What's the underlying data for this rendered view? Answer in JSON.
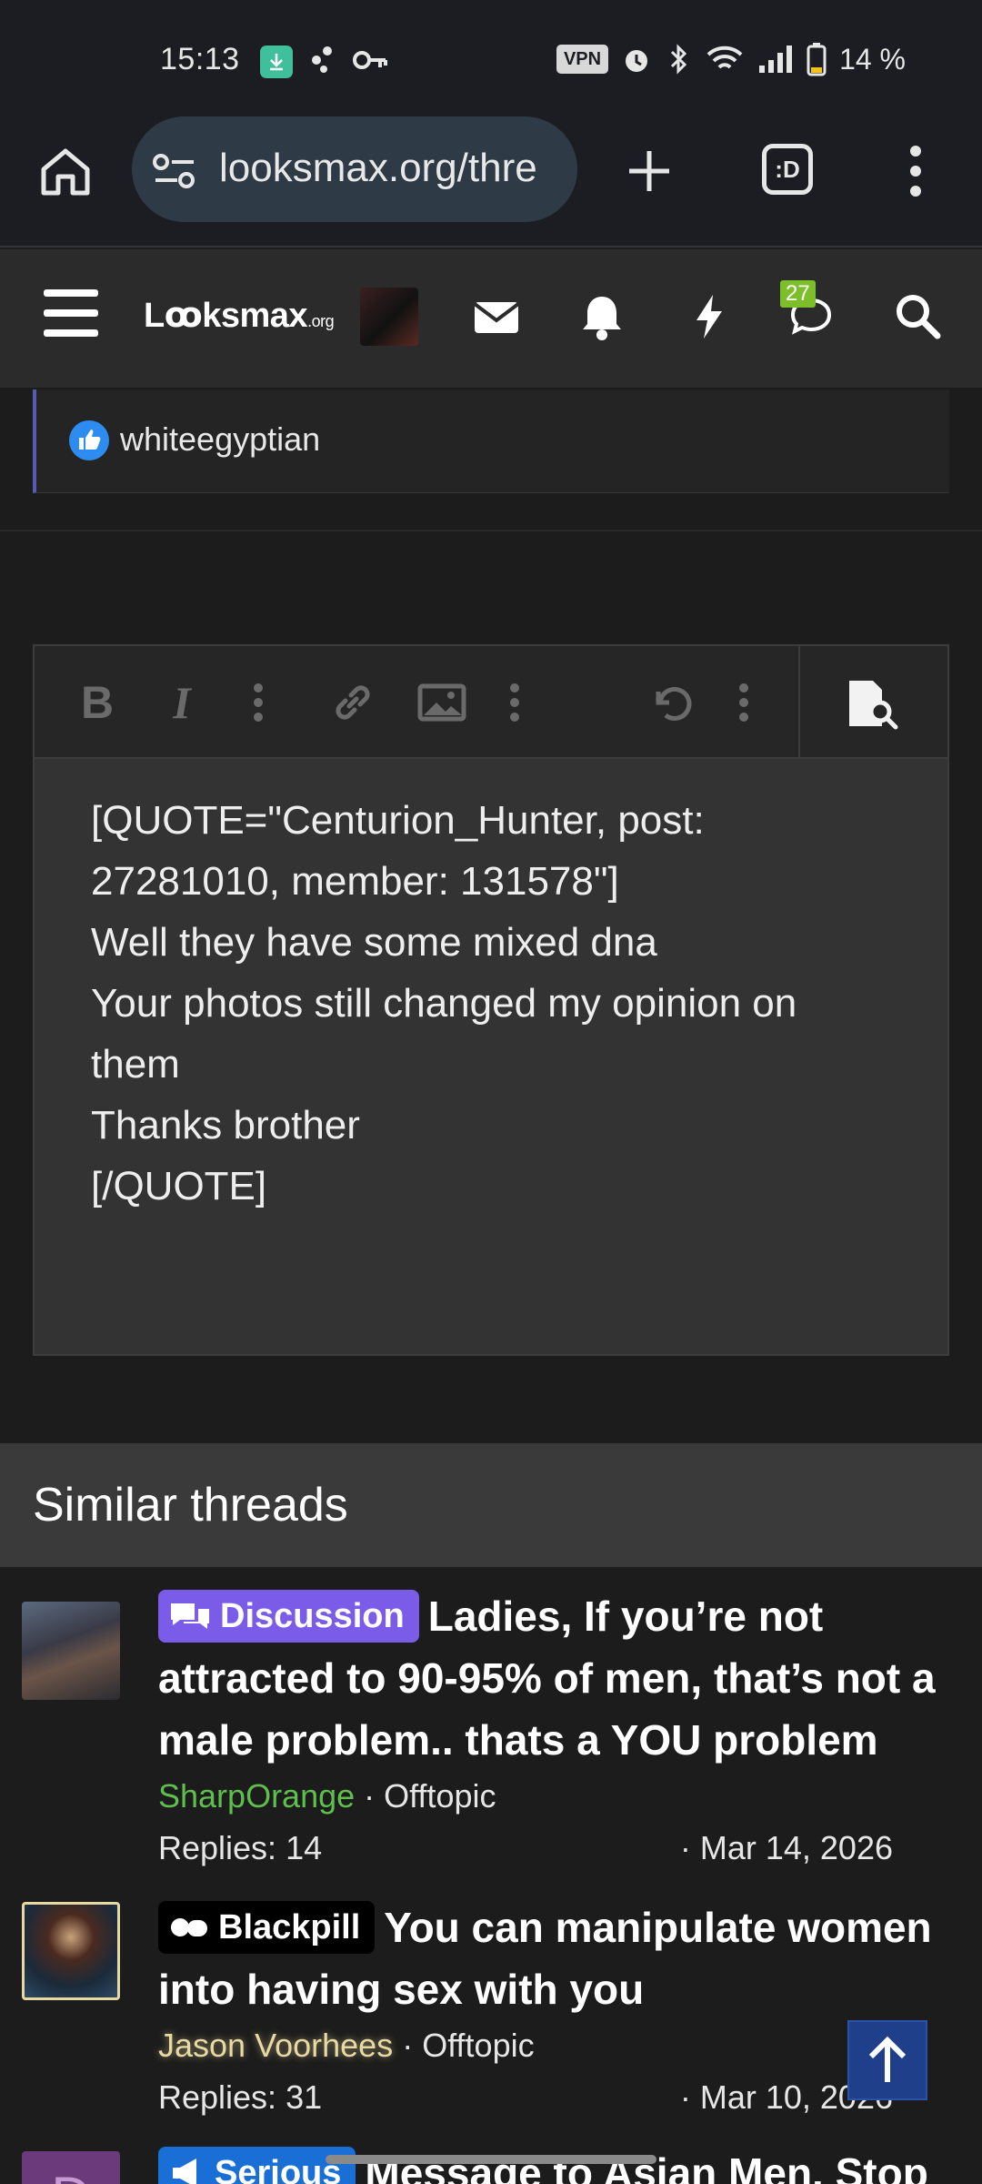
{
  "status_bar": {
    "time": "15:13",
    "vpn": "VPN",
    "battery": "14 %"
  },
  "browser": {
    "url": "looksmax.org/thre",
    "tab_label": ":D"
  },
  "site_nav": {
    "logo_main": "Lꝏksmax",
    "logo_suffix": ".org",
    "chat_badge": "27"
  },
  "reaction": {
    "user": "whiteegyptian"
  },
  "editor": {
    "content": "[QUOTE=\"Centurion_Hunter, post: 27281010, member: 131578\"]\nWell they have some mixed dna\nYour photos still changed my opinion on them\nThanks brother\n[/QUOTE]",
    "toolbar": {
      "bold": "B",
      "italic": "I"
    }
  },
  "similar": {
    "heading": "Similar threads",
    "threads": [
      {
        "prefix": "Discussion",
        "title": "Ladies, If you’re not attracted to 90-95% of men, that’s not a male problem.. thats a YOU problem",
        "author": "SharpOrange",
        "forum": "Offtopic",
        "replies": "Replies: 14",
        "date": "Mar 14, 2026"
      },
      {
        "prefix": "Blackpill",
        "title": "You can manipulate women into having sex with you",
        "author": "Jason Voorhees",
        "forum": "Offtopic",
        "replies": "Replies: 31",
        "date": "Mar 10, 2026"
      },
      {
        "avatar_letter": "D",
        "prefix": "Serious",
        "title": "Message to Asian Men. Stop"
      }
    ]
  },
  "colors": {
    "discussion": "#7a5ce8",
    "blackpill": "#000000",
    "serious": "#1a6fd6",
    "author_green": "#5fbf4c"
  }
}
